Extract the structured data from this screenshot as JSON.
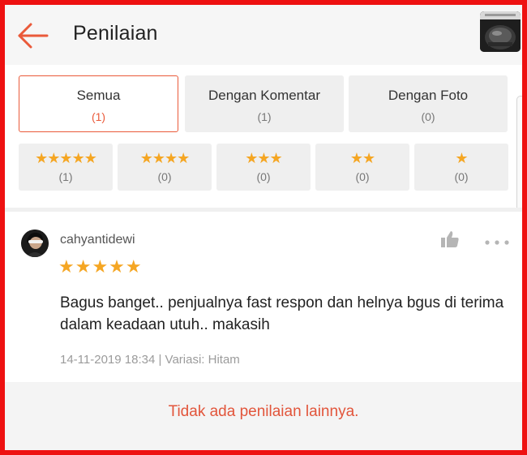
{
  "header": {
    "title": "Penilaian",
    "back_icon": "arrow-left-icon"
  },
  "colors": {
    "accent": "#ea5a3a",
    "star": "#f5a623",
    "frame": "#ee1111"
  },
  "filters": {
    "tabs": [
      {
        "label": "Semua",
        "count": "(1)",
        "active": true
      },
      {
        "label": "Dengan Komentar",
        "count": "(1)",
        "active": false
      },
      {
        "label": "Dengan Foto",
        "count": "(0)",
        "active": false
      }
    ],
    "star_filters": [
      {
        "stars": "★★★★★",
        "count": "(1)"
      },
      {
        "stars": "★★★★",
        "count": "(0)"
      },
      {
        "stars": "★★★",
        "count": "(0)"
      },
      {
        "stars": "★★",
        "count": "(0)"
      },
      {
        "stars": "★",
        "count": "(0)"
      }
    ]
  },
  "review": {
    "username": "cahyantidewi",
    "rating": 5,
    "stars": "★★★★★",
    "text": "Bagus banget.. penjualnya fast respon dan helnya bgus di terima dalam keadaan utuh.. makasih",
    "meta": "14-11-2019 18:34 | Variasi: Hitam"
  },
  "footer": {
    "no_more_text": "Tidak ada penilaian lainnya."
  }
}
